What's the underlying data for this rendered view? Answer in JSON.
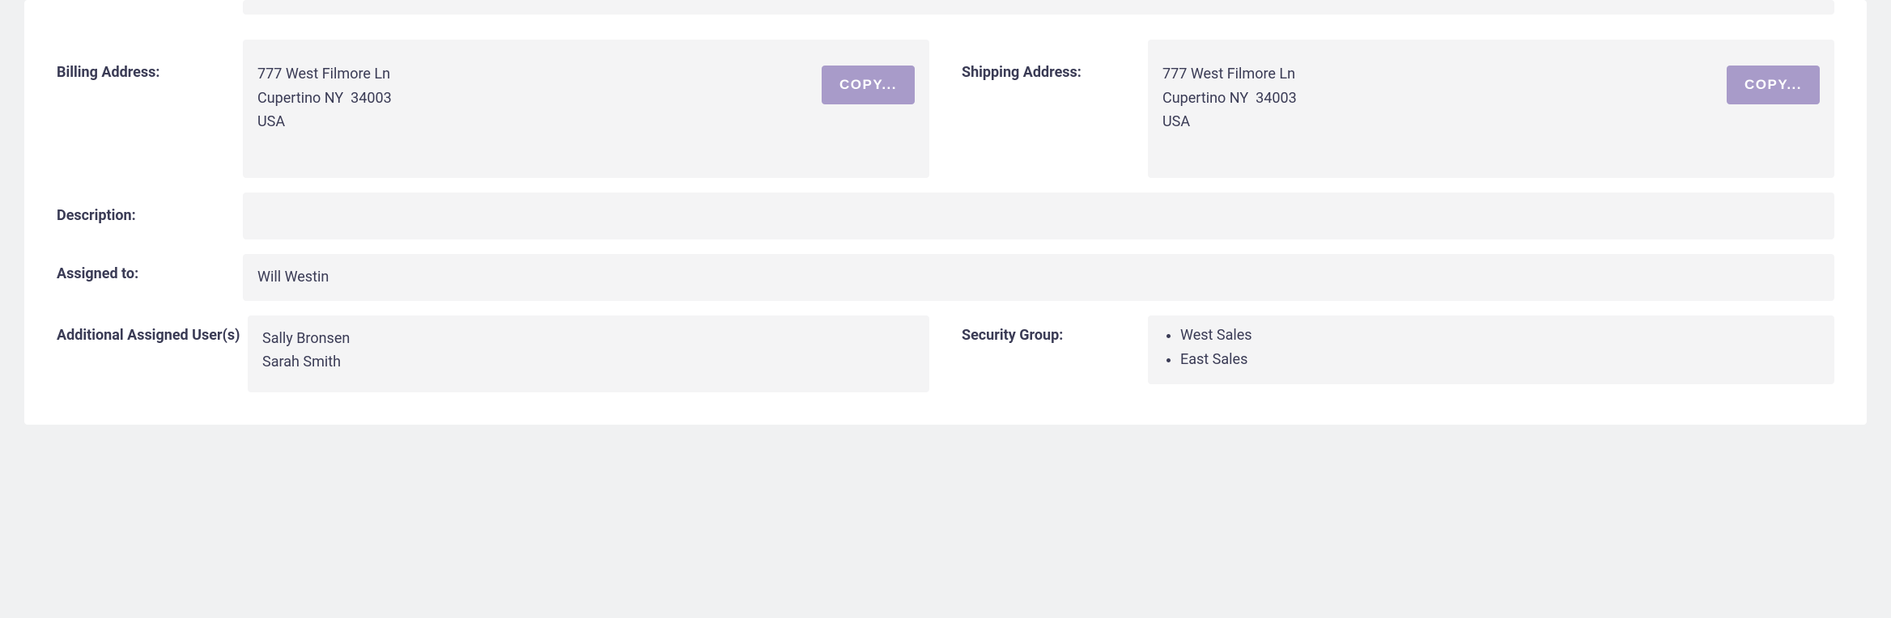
{
  "labels": {
    "billing_address": "Billing Address:",
    "shipping_address": "Shipping Address:",
    "description": "Description:",
    "assigned_to": "Assigned to:",
    "additional_assigned_users": "Additional Assigned User(s)",
    "security_group": "Security Group:"
  },
  "billing_address": {
    "line1": "777 West Filmore Ln",
    "line2": "Cupertino NY  34003",
    "line3": "USA"
  },
  "shipping_address": {
    "line1": "777 West Filmore Ln",
    "line2": "Cupertino NY  34003",
    "line3": "USA"
  },
  "buttons": {
    "copy": "COPY..."
  },
  "description": "",
  "assigned_to": "Will Westin",
  "additional_users": {
    "0": "Sally Bronsen",
    "1": "Sarah Smith"
  },
  "security_groups": {
    "0": "West Sales",
    "1": "East Sales"
  }
}
